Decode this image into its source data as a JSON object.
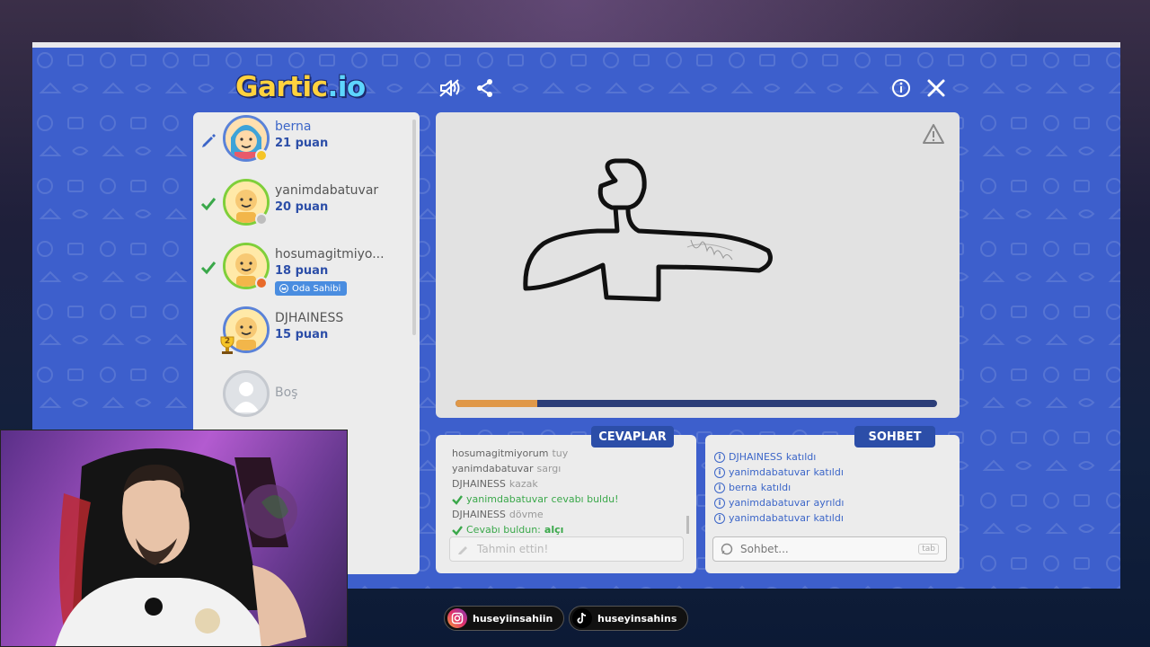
{
  "app": {
    "logo_text": "Gartic",
    "logo_suffix": ".io"
  },
  "players": [
    {
      "name": "berna",
      "points": "21 puan",
      "state": "drawing",
      "status_color": "#f5c426"
    },
    {
      "name": "yanimdabatuvar",
      "points": "20 puan",
      "state": "guessed",
      "status_color": "#bdbdbd"
    },
    {
      "name": "hosumagitmiyo...",
      "points": "18 puan",
      "state": "guessed",
      "status_color": "#e86a2a",
      "badge": "Oda Sahibi"
    },
    {
      "name": "DJHAINESS",
      "points": "15 puan",
      "state": "idle",
      "trophy_rank": "2"
    }
  ],
  "empty_slot": {
    "label": "Boş"
  },
  "timer": {
    "progress": 0.17
  },
  "answers": {
    "tab_label": "CEVAPLAR",
    "lines": [
      {
        "who": "hosumagitmiyorum",
        "what": "tuy"
      },
      {
        "who": "yanimdabatuvar",
        "what": "sargı"
      },
      {
        "who": "DJHAINESS",
        "what": "kazak"
      },
      {
        "who": "yanimdabatuvar",
        "what": "cevabı buldu!"
      },
      {
        "who": "DJHAINESS",
        "what": "dövme"
      },
      {
        "who": "Cevabı buldun:",
        "what": "alçı"
      }
    ],
    "input_placeholder": "Tahmin ettin!"
  },
  "chat": {
    "tab_label": "SOHBET",
    "lines": [
      {
        "who": "DJHAINESS",
        "what": "katıldı"
      },
      {
        "who": "yanimdabatuvar",
        "what": "katıldı"
      },
      {
        "who": "berna",
        "what": "katıldı"
      },
      {
        "who": "yanimdabatuvar",
        "what": "ayrıldı"
      },
      {
        "who": "yanimdabatuvar",
        "what": "katıldı"
      }
    ],
    "input_placeholder": "Sohbet...",
    "tab_key": "tab"
  },
  "socials": {
    "instagram": "huseyiinsahiin",
    "tiktok": "huseyinsahins"
  },
  "colors": {
    "game_bg": "#3d5fcc",
    "accent_dark": "#2c4ea8",
    "success": "#3aa84a",
    "timer_fill": "#e09848"
  }
}
